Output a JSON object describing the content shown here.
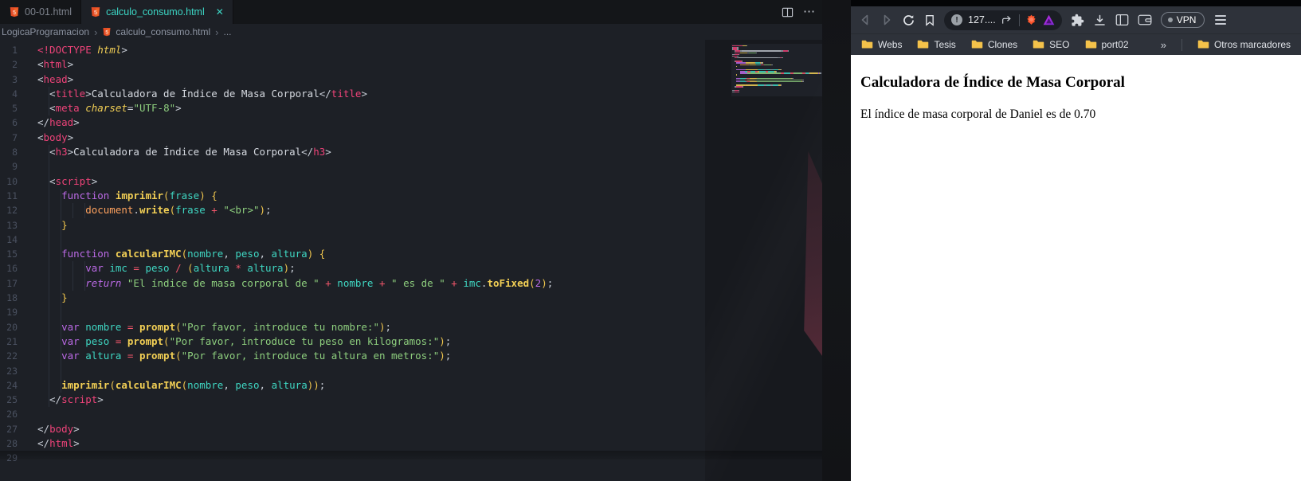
{
  "editor": {
    "tabs": [
      {
        "label": "00-01.html",
        "active": false
      },
      {
        "label": "calculo_consumo.html",
        "active": true,
        "close_glyph": "✕"
      }
    ],
    "breadcrumb": {
      "folder": "LogicaProgramacion",
      "sep": "›",
      "file": "calculo_consumo.html",
      "more": "..."
    },
    "code": {
      "lines": [
        [
          [
            "tag",
            "<!DOCTYPE "
          ],
          [
            "attr",
            "html"
          ],
          [
            "pun",
            ">"
          ]
        ],
        [
          [
            "pun",
            "<"
          ],
          [
            "tag",
            "html"
          ],
          [
            "pun",
            ">"
          ]
        ],
        [
          [
            "pun",
            "<"
          ],
          [
            "tag",
            "head"
          ],
          [
            "pun",
            ">"
          ]
        ],
        [
          [
            "ind",
            "  "
          ],
          [
            "pun",
            "<"
          ],
          [
            "tag",
            "title"
          ],
          [
            "pun",
            ">"
          ],
          [
            "txt",
            "Calculadora de Índice de Masa Corporal"
          ],
          [
            "pun",
            "</"
          ],
          [
            "tag",
            "title"
          ],
          [
            "pun",
            ">"
          ]
        ],
        [
          [
            "ind",
            "  "
          ],
          [
            "pun",
            "<"
          ],
          [
            "tag",
            "meta "
          ],
          [
            "attr",
            "charset"
          ],
          [
            "pun",
            "="
          ],
          [
            "str",
            "\"UTF-8\""
          ],
          [
            "pun",
            ">"
          ]
        ],
        [
          [
            "pun",
            "</"
          ],
          [
            "tag",
            "head"
          ],
          [
            "pun",
            ">"
          ]
        ],
        [
          [
            "pun",
            "<"
          ],
          [
            "tag",
            "body"
          ],
          [
            "pun",
            ">"
          ]
        ],
        [
          [
            "ind",
            "  "
          ],
          [
            "pun",
            "<"
          ],
          [
            "tag",
            "h3"
          ],
          [
            "pun",
            ">"
          ],
          [
            "txt",
            "Calculadora de Índice de Masa Corporal"
          ],
          [
            "pun",
            "</"
          ],
          [
            "tag",
            "h3"
          ],
          [
            "pun",
            ">"
          ]
        ],
        [
          [
            "ind",
            "  "
          ]
        ],
        [
          [
            "ind",
            "  "
          ],
          [
            "pun",
            "<"
          ],
          [
            "tag",
            "script"
          ],
          [
            "pun",
            ">"
          ]
        ],
        [
          [
            "ind",
            "    "
          ],
          [
            "kw",
            "function "
          ],
          [
            "fn",
            "imprimir"
          ],
          [
            "br",
            "("
          ],
          [
            "var",
            "frase"
          ],
          [
            "br",
            ")"
          ],
          [
            "txt",
            " "
          ],
          [
            "br",
            "{"
          ]
        ],
        [
          [
            "ind",
            "        "
          ],
          [
            "obj",
            "document"
          ],
          [
            "pun",
            "."
          ],
          [
            "fn",
            "write"
          ],
          [
            "br",
            "("
          ],
          [
            "var",
            "frase"
          ],
          [
            "op",
            " + "
          ],
          [
            "str",
            "\"<br>\""
          ],
          [
            "br",
            ")"
          ],
          [
            "pun",
            ";"
          ]
        ],
        [
          [
            "ind",
            "    "
          ],
          [
            "br",
            "}"
          ]
        ],
        [
          [
            "ind",
            "    "
          ]
        ],
        [
          [
            "ind",
            "    "
          ],
          [
            "kw",
            "function "
          ],
          [
            "fn",
            "calcularIMC"
          ],
          [
            "br",
            "("
          ],
          [
            "var",
            "nombre"
          ],
          [
            "pun",
            ", "
          ],
          [
            "var",
            "peso"
          ],
          [
            "pun",
            ", "
          ],
          [
            "var",
            "altura"
          ],
          [
            "br",
            ")"
          ],
          [
            "txt",
            " "
          ],
          [
            "br",
            "{"
          ]
        ],
        [
          [
            "ind",
            "        "
          ],
          [
            "kw",
            "var "
          ],
          [
            "var",
            "imc"
          ],
          [
            "op",
            " = "
          ],
          [
            "var",
            "peso"
          ],
          [
            "op",
            " / "
          ],
          [
            "br",
            "("
          ],
          [
            "var",
            "altura"
          ],
          [
            "op",
            " * "
          ],
          [
            "var",
            "altura"
          ],
          [
            "br",
            ")"
          ],
          [
            "pun",
            ";"
          ]
        ],
        [
          [
            "ind",
            "        "
          ],
          [
            "kwi",
            "return "
          ],
          [
            "str",
            "\"El índice de masa corporal de \""
          ],
          [
            "op",
            " + "
          ],
          [
            "var",
            "nombre"
          ],
          [
            "op",
            " + "
          ],
          [
            "str",
            "\" es de \""
          ],
          [
            "op",
            " + "
          ],
          [
            "var",
            "imc"
          ],
          [
            "pun",
            "."
          ],
          [
            "fn",
            "toFixed"
          ],
          [
            "br",
            "("
          ],
          [
            "num",
            "2"
          ],
          [
            "br",
            ")"
          ],
          [
            "pun",
            ";"
          ]
        ],
        [
          [
            "ind",
            "    "
          ],
          [
            "br",
            "}"
          ]
        ],
        [
          [
            "ind",
            "    "
          ]
        ],
        [
          [
            "ind",
            "    "
          ],
          [
            "kw",
            "var "
          ],
          [
            "var",
            "nombre"
          ],
          [
            "op",
            " = "
          ],
          [
            "fn",
            "prompt"
          ],
          [
            "br",
            "("
          ],
          [
            "str",
            "\"Por favor, introduce tu nombre:\""
          ],
          [
            "br",
            ")"
          ],
          [
            "pun",
            ";"
          ]
        ],
        [
          [
            "ind",
            "    "
          ],
          [
            "kw",
            "var "
          ],
          [
            "var",
            "peso"
          ],
          [
            "op",
            " = "
          ],
          [
            "fn",
            "prompt"
          ],
          [
            "br",
            "("
          ],
          [
            "str",
            "\"Por favor, introduce tu peso en kilogramos:\""
          ],
          [
            "br",
            ")"
          ],
          [
            "pun",
            ";"
          ]
        ],
        [
          [
            "ind",
            "    "
          ],
          [
            "kw",
            "var "
          ],
          [
            "var",
            "altura"
          ],
          [
            "op",
            " = "
          ],
          [
            "fn",
            "prompt"
          ],
          [
            "br",
            "("
          ],
          [
            "str",
            "\"Por favor, introduce tu altura en metros:\""
          ],
          [
            "br",
            ")"
          ],
          [
            "pun",
            ";"
          ]
        ],
        [
          [
            "ind",
            "    "
          ]
        ],
        [
          [
            "ind",
            "    "
          ],
          [
            "fn",
            "imprimir"
          ],
          [
            "br",
            "("
          ],
          [
            "fn",
            "calcularIMC"
          ],
          [
            "br",
            "("
          ],
          [
            "var",
            "nombre"
          ],
          [
            "pun",
            ", "
          ],
          [
            "var",
            "peso"
          ],
          [
            "pun",
            ", "
          ],
          [
            "var",
            "altura"
          ],
          [
            "br",
            "))"
          ],
          [
            "pun",
            ";"
          ]
        ],
        [
          [
            "ind",
            "  "
          ],
          [
            "pun",
            "</"
          ],
          [
            "tag",
            "script"
          ],
          [
            "pun",
            ">"
          ]
        ],
        [],
        [
          [
            "pun",
            "</"
          ],
          [
            "tag",
            "body"
          ],
          [
            "pun",
            ">"
          ]
        ],
        [
          [
            "pun",
            "</"
          ],
          [
            "tag",
            "html"
          ],
          [
            "pun",
            ">"
          ]
        ],
        []
      ]
    }
  },
  "browser": {
    "toolbar": {
      "address": "127....",
      "vpn_label": "VPN"
    },
    "bookmarks": [
      "Webs",
      "Tesis",
      "Clones",
      "SEO",
      "port02"
    ],
    "bookmarks_overflow": "»",
    "other_bookmarks": "Otros marcadores",
    "page": {
      "heading": "Calculadora de Índice de Masa Corporal",
      "body_text": "El índice de masa corporal de Daniel es de 0.70"
    }
  },
  "colors": {
    "accent_teal": "#3cd6c5",
    "tag_pink": "#ee4379",
    "keyword_purple": "#bb6ae6",
    "function_gold": "#f2cf55",
    "string_green": "#8ecf7e",
    "variable_teal": "#3fd6c2",
    "operator_red": "#f2566b",
    "object_orange": "#ffa25e",
    "folder_yellow": "#f4c24a",
    "brave_orange": "#fb542b",
    "rewards_purple": "#a733d4"
  }
}
